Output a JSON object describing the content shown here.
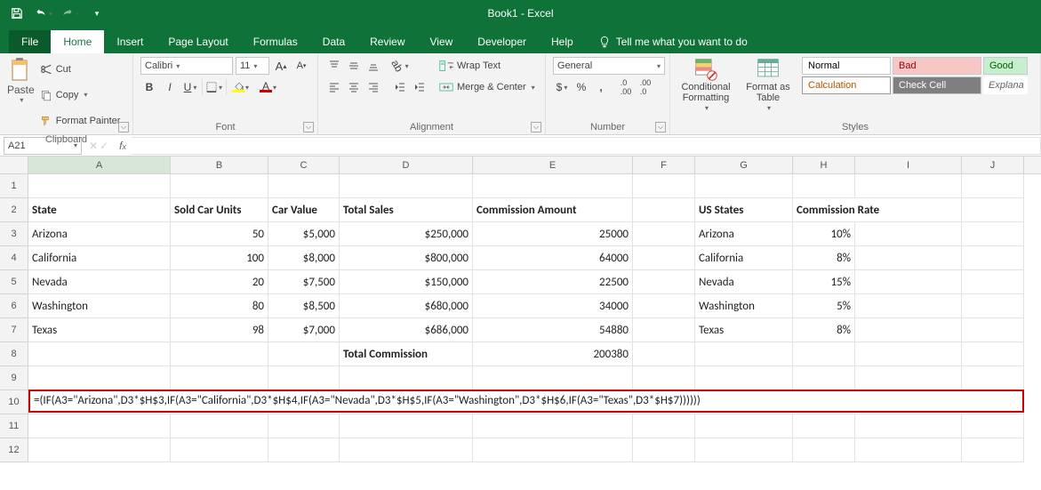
{
  "app": {
    "title": "Book1 - Excel"
  },
  "tabs": {
    "file": "File",
    "home": "Home",
    "insert": "Insert",
    "page_layout": "Page Layout",
    "formulas": "Formulas",
    "data": "Data",
    "review": "Review",
    "view": "View",
    "developer": "Developer",
    "help": "Help",
    "tellme": "Tell me what you want to do"
  },
  "ribbon": {
    "clipboard": {
      "label": "Clipboard",
      "paste": "Paste",
      "cut": "Cut",
      "copy": "Copy",
      "painter": "Format Painter"
    },
    "font": {
      "label": "Font",
      "name": "Calibri",
      "size": "11"
    },
    "alignment": {
      "label": "Alignment",
      "wrap": "Wrap Text",
      "merge": "Merge & Center"
    },
    "number": {
      "label": "Number",
      "format": "General"
    },
    "styles": {
      "label": "Styles",
      "cond": "Conditional Formatting",
      "ftable": "Format as Table",
      "normal": "Normal",
      "bad": "Bad",
      "good": "Good",
      "calc": "Calculation",
      "check": "Check Cell",
      "expl": "Explana"
    }
  },
  "namebox": {
    "ref": "A21"
  },
  "columns": [
    "A",
    "B",
    "C",
    "D",
    "E",
    "F",
    "G",
    "H",
    "I",
    "J"
  ],
  "headers": {
    "A": "State",
    "B": "Sold Car Units",
    "C": "Car Value",
    "D": "Total Sales",
    "E": "Commission Amount",
    "G": "US States",
    "H": "Commission Rate",
    "I": ""
  },
  "data": {
    "r3": {
      "A": "Arizona",
      "B": "50",
      "C": "$5,000",
      "D": "$250,000",
      "E": "25000",
      "G": "Arizona",
      "H": "10%"
    },
    "r4": {
      "A": "California",
      "B": "100",
      "C": "$8,000",
      "D": "$800,000",
      "E": "64000",
      "G": "California",
      "H": "8%"
    },
    "r5": {
      "A": "Nevada",
      "B": "20",
      "C": "$7,500",
      "D": "$150,000",
      "E": "22500",
      "G": "Nevada",
      "H": "15%"
    },
    "r6": {
      "A": "Washington",
      "B": "80",
      "C": "$8,500",
      "D": "$680,000",
      "E": "34000",
      "G": "Washington",
      "H": "5%"
    },
    "r7": {
      "A": "Texas",
      "B": "98",
      "C": "$7,000",
      "D": "$686,000",
      "E": "54880",
      "G": "Texas",
      "H": "8%"
    }
  },
  "totals": {
    "label": "Total Commission",
    "value": "200380"
  },
  "formula": "=(IF(A3=\"Arizona\",D3*$H$3,IF(A3=\"California\",D3*$H$4,IF(A3=\"Nevada\",D3*$H$5,IF(A3=\"Washington\",D3*$H$6,IF(A3=\"Texas\",D3*$H$7))))))",
  "rownums": [
    "1",
    "2",
    "3",
    "4",
    "5",
    "6",
    "7",
    "8",
    "9",
    "10",
    "11",
    "12"
  ]
}
